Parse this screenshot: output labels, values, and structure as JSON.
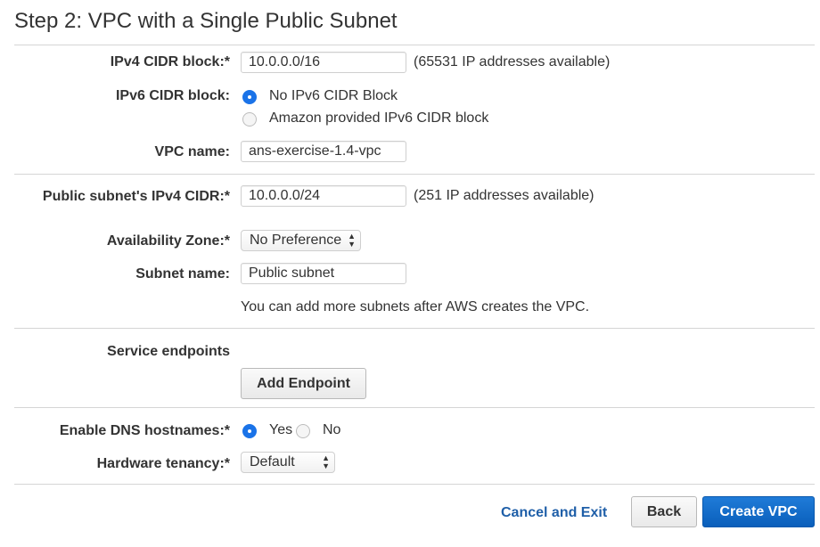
{
  "page": {
    "title": "Step 2: VPC with a Single Public Subnet"
  },
  "ipv4_cidr": {
    "label": "IPv4 CIDR block:*",
    "value": "10.0.0.0/16",
    "hint": "(65531 IP addresses available)"
  },
  "ipv6_cidr": {
    "label": "IPv6 CIDR block:",
    "options": [
      {
        "label": "No IPv6 CIDR Block",
        "checked": true
      },
      {
        "label": "Amazon provided IPv6 CIDR block",
        "checked": false
      }
    ]
  },
  "vpc_name": {
    "label": "VPC name:",
    "value": "ans-exercise-1.4-vpc"
  },
  "subnet_cidr": {
    "label": "Public subnet's IPv4 CIDR:*",
    "value": "10.0.0.0/24",
    "hint": "(251 IP addresses available)"
  },
  "availability_zone": {
    "label": "Availability Zone:*",
    "value": "No Preference"
  },
  "subnet_name": {
    "label": "Subnet name:",
    "value": "Public subnet",
    "note": "You can add more subnets after AWS creates the VPC."
  },
  "service_endpoints": {
    "label": "Service endpoints",
    "button": "Add Endpoint"
  },
  "dns_hostnames": {
    "label": "Enable DNS hostnames:*",
    "options": [
      {
        "label": "Yes",
        "checked": true
      },
      {
        "label": "No",
        "checked": false
      }
    ]
  },
  "hardware_tenancy": {
    "label": "Hardware tenancy:*",
    "value": "Default"
  },
  "footer": {
    "cancel": "Cancel and Exit",
    "back": "Back",
    "create": "Create VPC"
  },
  "colors": {
    "accent": "#1a73e8",
    "primary_button": "#0a5fbb",
    "link": "#1f5fa8"
  }
}
